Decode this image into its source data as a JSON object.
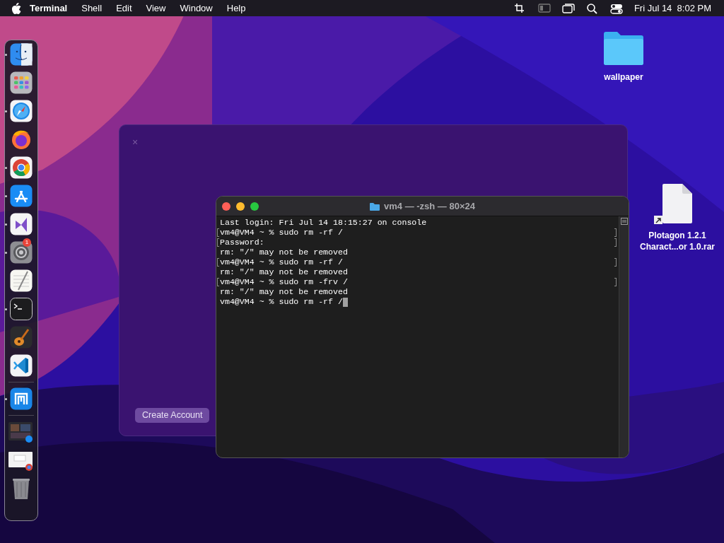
{
  "menu_bar": {
    "app_name": "Terminal",
    "menus": [
      "Shell",
      "Edit",
      "View",
      "Window",
      "Help"
    ],
    "status_icons": [
      {
        "kind": "crop"
      },
      {
        "kind": "screen"
      },
      {
        "kind": "windows"
      },
      {
        "kind": "search"
      },
      {
        "kind": "control"
      }
    ],
    "clock": "Fri Jul 14  8:02 PM"
  },
  "dock": {
    "items": [
      {
        "kind": "finder",
        "running": true
      },
      {
        "kind": "launchpad",
        "running": false
      },
      {
        "kind": "safari",
        "running": true
      },
      {
        "kind": "firefox",
        "running": false
      },
      {
        "kind": "chrome",
        "running": true
      },
      {
        "kind": "appstore",
        "running": true
      },
      {
        "kind": "visualstudio",
        "running": true
      },
      {
        "kind": "settings",
        "running": true,
        "badge": "1"
      },
      {
        "kind": "textedit",
        "running": false
      },
      {
        "kind": "terminal",
        "running": true
      },
      {
        "kind": "garageband",
        "running": false
      },
      {
        "kind": "vscode",
        "running": false
      },
      {
        "kind": "divider"
      },
      {
        "kind": "maxthon",
        "running": true
      },
      {
        "kind": "divider"
      },
      {
        "kind": "stack_photos"
      },
      {
        "kind": "stack_docs"
      },
      {
        "kind": "trash"
      }
    ]
  },
  "desktop_icons": [
    {
      "kind": "folder",
      "label": "wallpaper"
    },
    {
      "kind": "file",
      "label": "Plotagon 1.2.1\nCharact...or 1.0.rar"
    }
  ],
  "background_window": {
    "close": "×",
    "button": "Create Account"
  },
  "terminal": {
    "title": "vm4 — -zsh — 80×24",
    "lines": [
      {
        "text": "Last login: Fri Jul 14 18:15:27 on console",
        "marked": false
      },
      {
        "text": "vm4@VM4 ~ % sudo rm -rf /",
        "marked": true
      },
      {
        "text": "Password:",
        "marked": true
      },
      {
        "text": "rm: \"/\" may not be removed",
        "marked": false
      },
      {
        "text": "vm4@VM4 ~ % sudo rm -rf /",
        "marked": true
      },
      {
        "text": "rm: \"/\" may not be removed",
        "marked": false
      },
      {
        "text": "vm4@VM4 ~ % sudo rm -frv /",
        "marked": true
      },
      {
        "text": "rm: \"/\" may not be removed",
        "marked": false
      },
      {
        "text": "vm4@VM4 ~ % sudo rm -rf /",
        "marked": false,
        "cursor": true
      }
    ]
  }
}
